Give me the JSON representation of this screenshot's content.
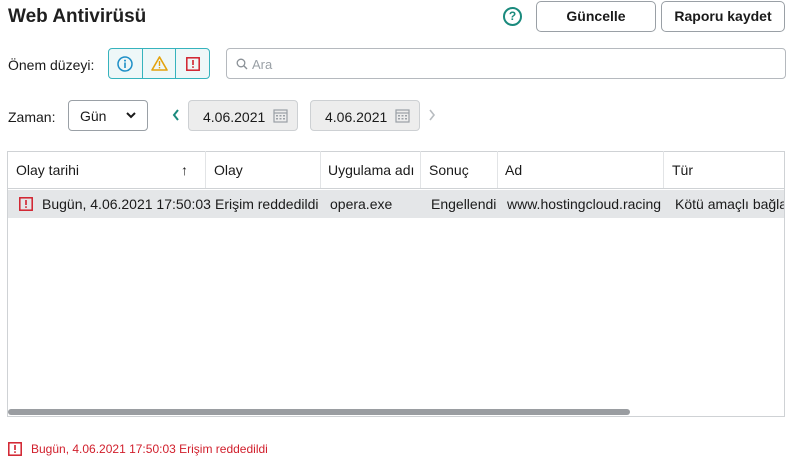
{
  "header": {
    "title": "Web Antivirüsü",
    "help_icon": "?",
    "update_label": "Güncelle",
    "save_report_label": "Raporu kaydet"
  },
  "filters": {
    "severity_label": "Önem düzeyi:",
    "search_placeholder": "Ara",
    "time_label": "Zaman:",
    "period_value": "Gün",
    "date_from": "4.06.2021",
    "date_to": "4.06.2021"
  },
  "table": {
    "columns": [
      "Olay tarihi",
      "Olay",
      "Uygulama adı",
      "Sonuç",
      "Ad",
      "Tür"
    ],
    "sort_indicator": "↑",
    "rows": [
      {
        "date": "Bugün, 4.06.2021 17:50:03",
        "event": "Erişim reddedildi",
        "app": "opera.exe",
        "result": "Engellendi",
        "name": "www.hostingcloud.racing",
        "type": "Kötü amaçlı bağla"
      }
    ]
  },
  "status_bar": {
    "text": "Bugün, 4.06.2021 17:50:03 Erişim reddedildi"
  },
  "colors": {
    "accent": "#1a8a7d",
    "info": "#1e8fc7",
    "warning": "#e3a20d",
    "critical": "#d11f2c"
  }
}
